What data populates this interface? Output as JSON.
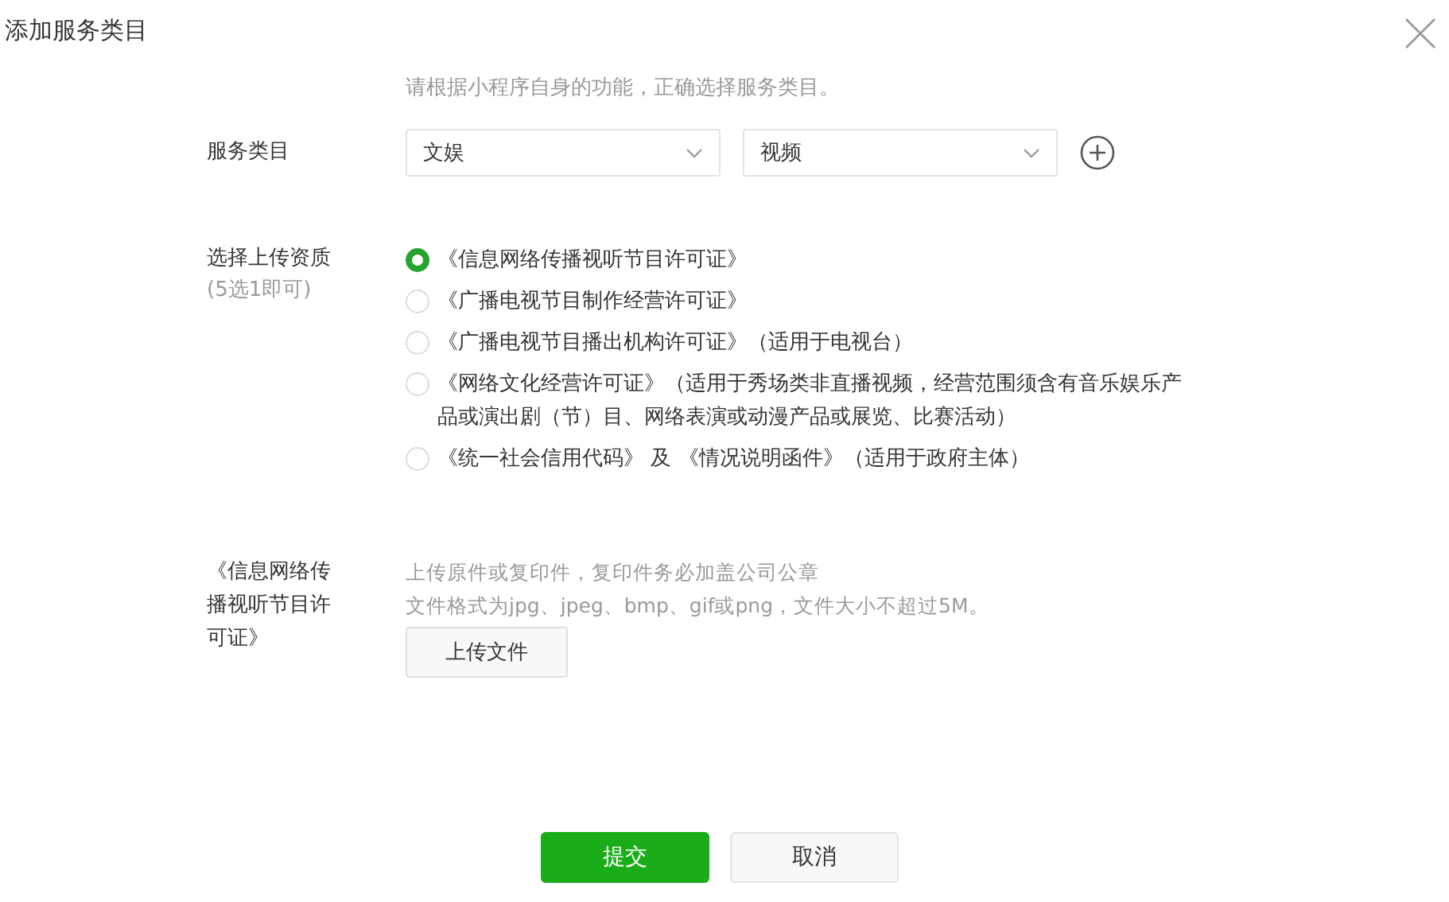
{
  "dialog": {
    "title": "添加服务类目"
  },
  "hint": "请根据小程序自身的功能，正确选择服务类目。",
  "category": {
    "label": "服务类目",
    "selects": [
      {
        "value": "文娱"
      },
      {
        "value": "视频"
      }
    ]
  },
  "qualification": {
    "label": "选择上传资质",
    "sublabel": "(5选1即可)",
    "options": [
      {
        "label": "《信息网络传播视听节目许可证》",
        "selected": true
      },
      {
        "label": "《广播电视节目制作经营许可证》",
        "selected": false
      },
      {
        "label": "《广播电视节目播出机构许可证》（适用于电视台）",
        "selected": false
      },
      {
        "label": "《网络文化经营许可证》（适用于秀场类非直播视频，经营范围须含有音乐娱乐产品或演出剧（节）目、网络表演或动漫产品或展览、比赛活动）",
        "selected": false
      },
      {
        "label": "《统一社会信用代码》 及 《情况说明函件》（适用于政府主体）",
        "selected": false
      }
    ]
  },
  "upload": {
    "label": "《信息网络传播视听节目许可证》",
    "notes": [
      "上传原件或复印件，复印件务必加盖公司公章",
      "文件格式为jpg、jpeg、bmp、gif或png，文件大小不超过5M。"
    ],
    "button": "上传文件"
  },
  "buttons": [
    {
      "label": "提交",
      "kind": "primary"
    },
    {
      "label": "取消",
      "kind": "default"
    }
  ]
}
